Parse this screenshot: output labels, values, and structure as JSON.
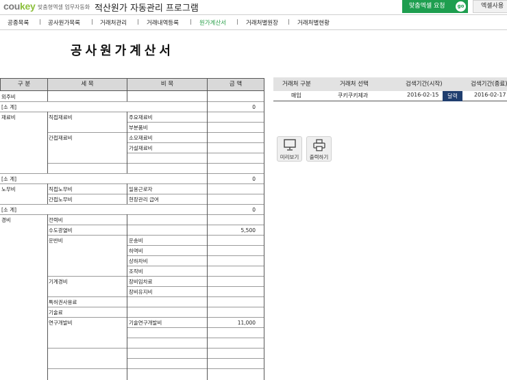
{
  "header": {
    "logo_left": "cou",
    "logo_right": "key",
    "tagline": "맞춤형엑셀 업무자동화",
    "title": "적산원가 자동관리 프로그램",
    "request_button": "맞춤엑셀 요청",
    "go_badge": "go",
    "help_button": "엑셀사용"
  },
  "nav": {
    "items": [
      "공종목록",
      "공사원가목록",
      "거래처관리",
      "거래내역등록",
      "원가계산서",
      "거래처별원장",
      "거래처별현황"
    ],
    "active_index": 4,
    "separator": "|",
    "active_color": "#2aa04a"
  },
  "document": {
    "title": "공사원가계산서"
  },
  "cost_table": {
    "headers": [
      "구  분",
      "세  목",
      "비  목",
      "금  액"
    ],
    "cells": {
      "r1_cat": "외주비",
      "sub1": "[소  계]",
      "sub1_amt": "0",
      "mat_cat": "재료비",
      "mat_direct": "직접재료비",
      "mat_direct_i1": "주요재료비",
      "mat_direct_i2": "부분품비",
      "mat_indirect": "간접재료비",
      "mat_indirect_i1": "소모재료비",
      "mat_indirect_i2": "가설재료비",
      "sub2": "[소  계]",
      "sub2_amt": "0",
      "lab_cat": "노무비",
      "lab_direct": "직접노무비",
      "lab_direct_i1": "일용근로자",
      "lab_indirect": "간접노무비",
      "lab_indirect_i1": "현장관리 급여",
      "sub3": "[소  계]",
      "sub3_amt": "0",
      "exp_cat": "경비",
      "exp_electric": "전력비",
      "exp_water": "수도광열비",
      "exp_water_amt": "5,500",
      "exp_transport": "운반비",
      "exp_transport_i1": "운송비",
      "exp_transport_i2": "하역비",
      "exp_transport_i3": "상하차비",
      "exp_transport_i4": "조작비",
      "exp_machine": "기계경비",
      "exp_machine_i1": "장비임차료",
      "exp_machine_i2": "장비유지비",
      "exp_patent": "특허권사용료",
      "exp_tech": "기술료",
      "exp_rnd": "연구개발비",
      "exp_rnd_i1": "기술연구개발비",
      "exp_rnd_amt": "11,000"
    }
  },
  "filter": {
    "headers": [
      "거래처 구분",
      "거래처 선택",
      "검색기간(시작)",
      "검색기간(종료)"
    ],
    "values": {
      "type": "매입",
      "vendor": "쿠키쿠키제과",
      "start": "2016-02-15",
      "end": "2016-02-17"
    },
    "calendar_button": "달력",
    "header_bg": "#e2e2e2"
  },
  "actions": {
    "preview": "미리보기",
    "print": "출력하기"
  }
}
